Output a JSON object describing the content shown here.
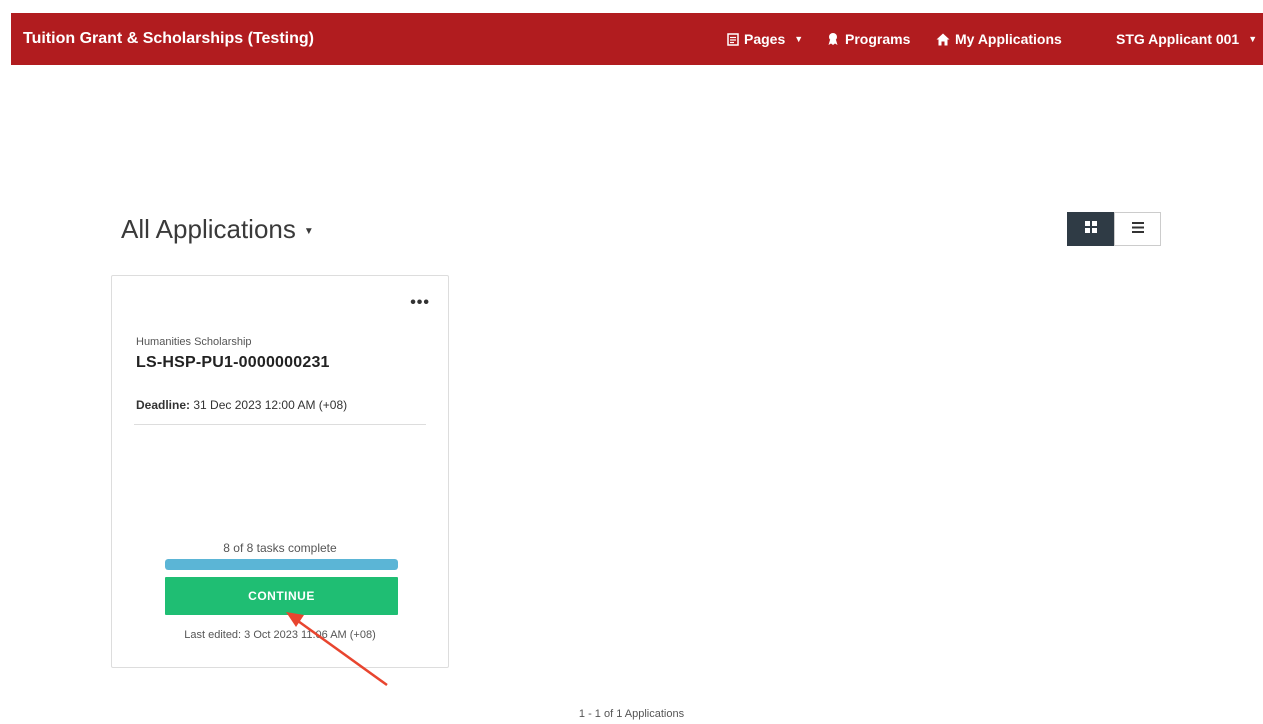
{
  "header": {
    "title": "Tuition Grant & Scholarships (Testing)",
    "nav": [
      {
        "label": "Pages",
        "icon": "document-icon"
      },
      {
        "label": "Programs",
        "icon": "award-icon"
      },
      {
        "label": "My Applications",
        "icon": "home-icon"
      }
    ],
    "user": "STG Applicant 001"
  },
  "main": {
    "heading": "All Applications",
    "view_modes": [
      "grid-view",
      "list-view"
    ],
    "active_view": "grid-view"
  },
  "application_card": {
    "program": "Humanities Scholarship",
    "application_id": "LS-HSP-PU1-0000000231",
    "deadline_label": "Deadline:",
    "deadline_value": "31 Dec 2023 12:00 AM (+08)",
    "tasks_text": "8 of 8 tasks complete",
    "progress_fraction": 1.0,
    "button_label": "CONTINUE",
    "last_edited": "Last edited: 3 Oct 2023 11:06 AM (+08)"
  },
  "pagination": {
    "summary": "1 - 1 of 1 Applications"
  },
  "colors": {
    "navbar": "#b11c1f",
    "continue_button": "#1fbe73",
    "progress_bar": "#5bb5d6",
    "toggle_active": "#2f3b45",
    "annotation_arrow": "#e8452f"
  }
}
